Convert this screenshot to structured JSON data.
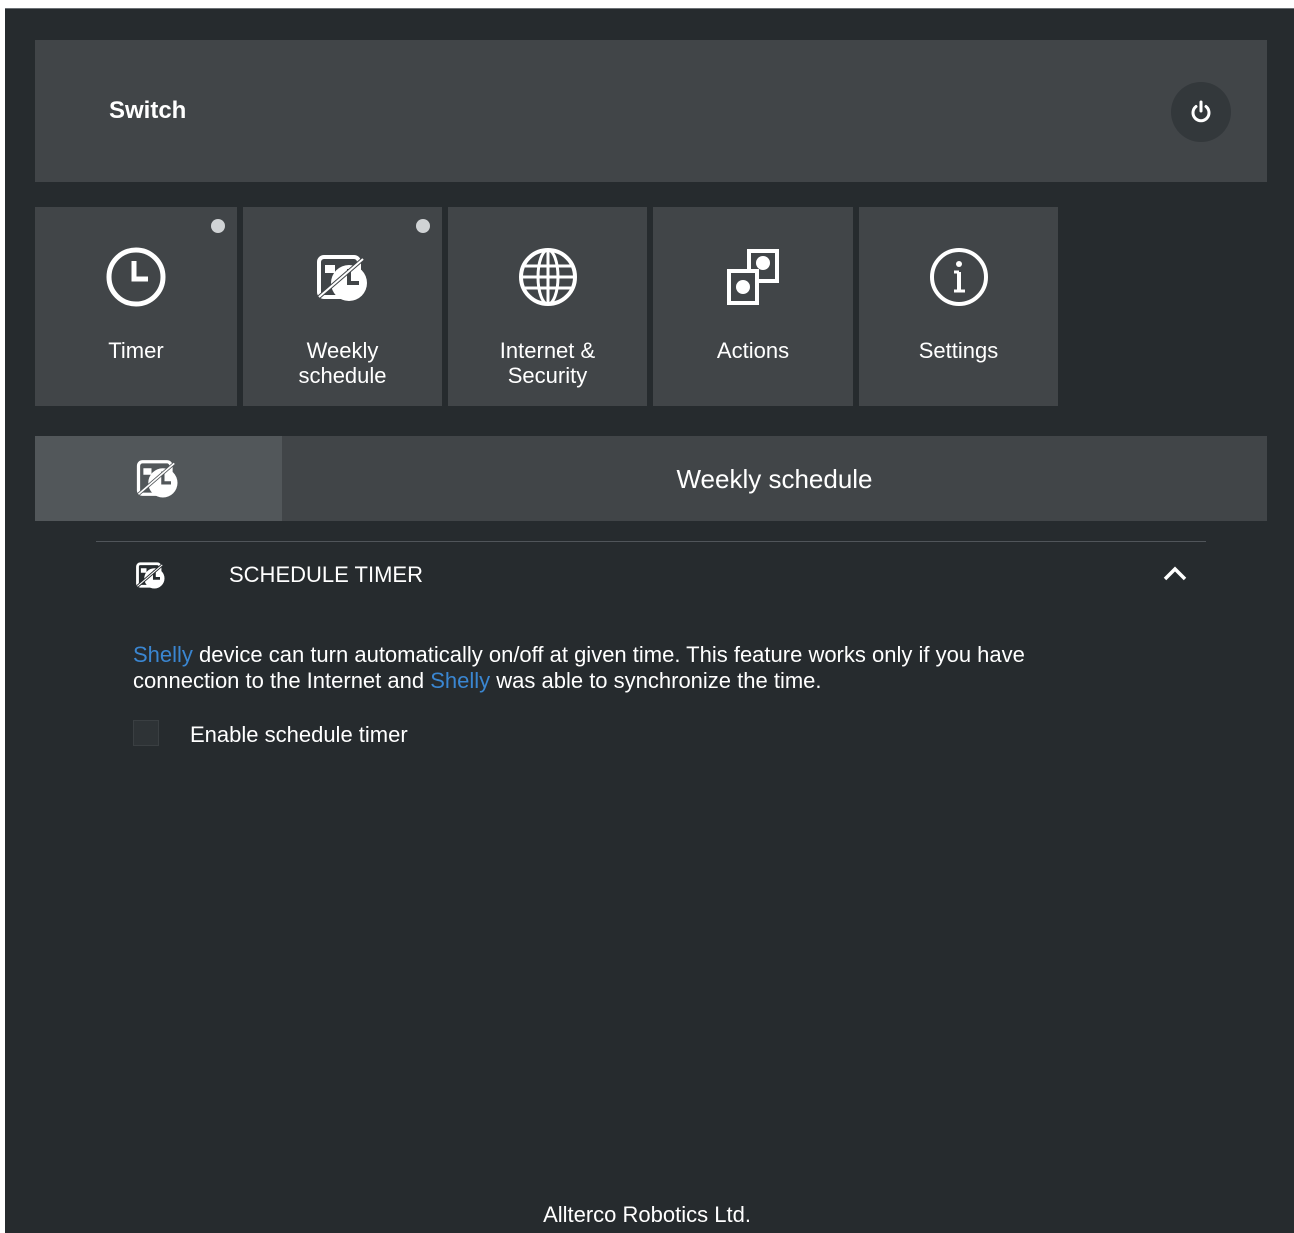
{
  "header": {
    "title": "Switch",
    "power_icon": "power-icon"
  },
  "tiles": [
    {
      "label": "Timer",
      "icon": "clock-icon",
      "indicator": true
    },
    {
      "label": "Weekly\nschedule",
      "icon": "calendar-schedule-icon",
      "indicator": true
    },
    {
      "label": "Internet &\nSecurity",
      "icon": "globe-icon",
      "indicator": false
    },
    {
      "label": "Actions",
      "icon": "actions-icon",
      "indicator": false
    },
    {
      "label": "Settings",
      "icon": "info-icon",
      "indicator": false
    }
  ],
  "section": {
    "title": "Weekly schedule",
    "icon": "calendar-schedule-icon"
  },
  "accordion": {
    "title": "SCHEDULE TIMER",
    "icon": "calendar-schedule-icon",
    "expanded": true
  },
  "description": {
    "brand": "Shelly",
    "part1": " device can turn automatically on/off at given time. This feature works only if you have connection to the Internet and ",
    "part2": " was able to synchronize the time."
  },
  "enable_checkbox": {
    "label": "Enable schedule timer",
    "checked": false
  },
  "footer": {
    "text": "Allterco Robotics Ltd."
  },
  "colors": {
    "background": "#262b2e",
    "panel": "#414548",
    "panel_active": "#52575a",
    "brand_link": "#3a86d1",
    "indicator": "#d0d3d5"
  }
}
